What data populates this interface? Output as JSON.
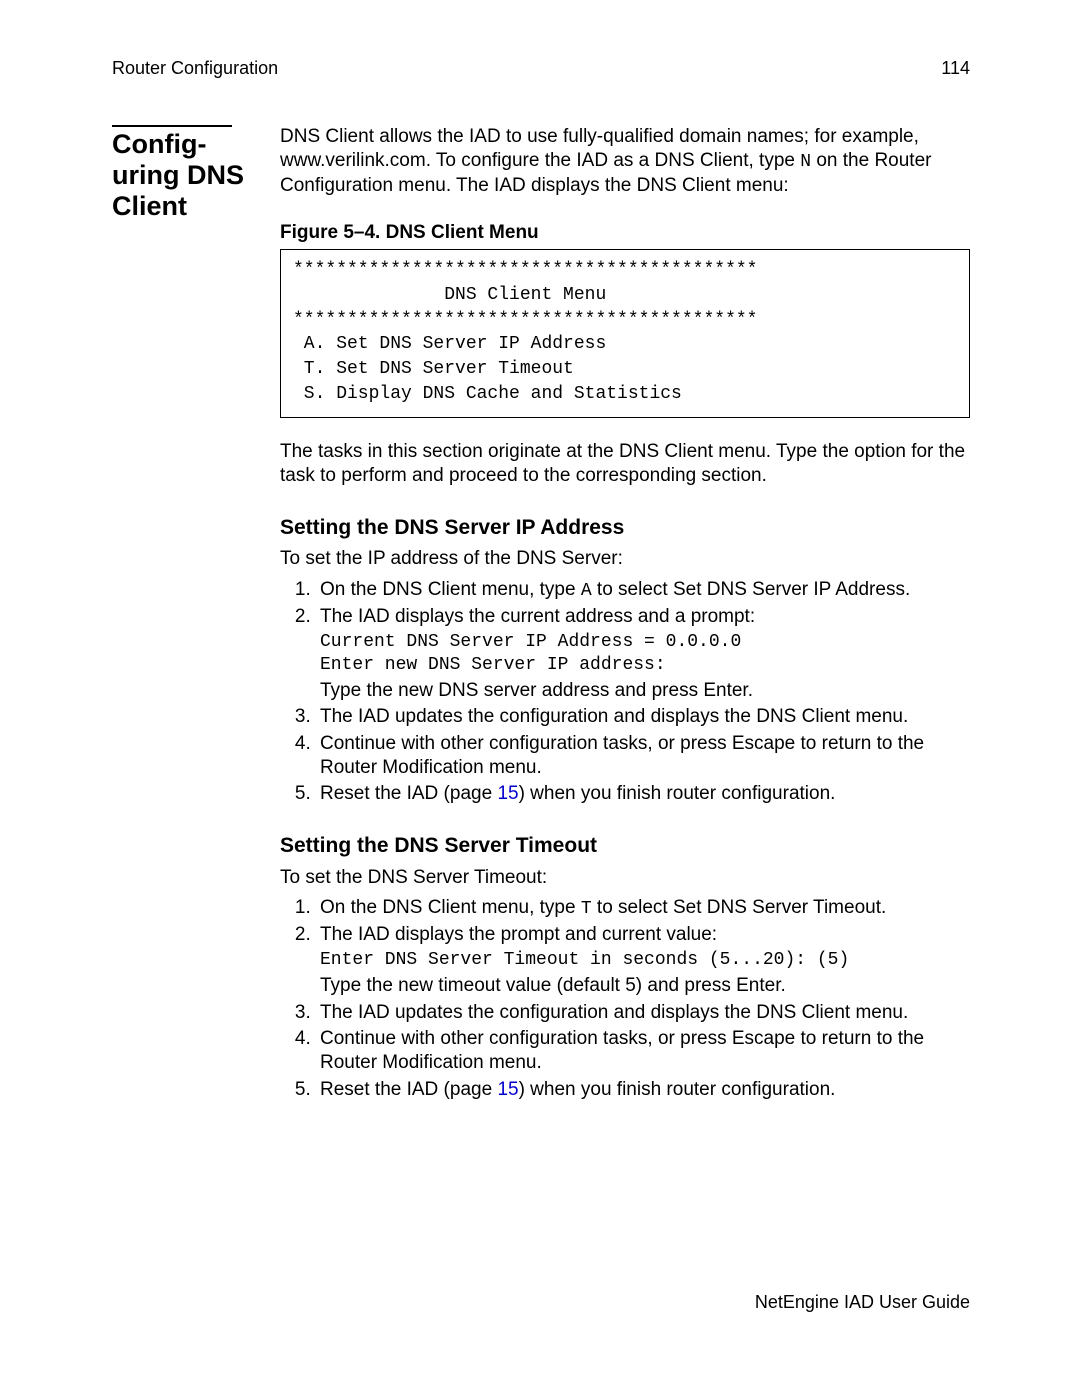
{
  "header": {
    "left": "Router Configuration",
    "right": "114"
  },
  "side_heading": "Config-\nuring DNS\nClient",
  "intro": "DNS Client allows the IAD to use fully-qualified domain names; for example, www.verilink.com. To configure the IAD as a DNS Client, type ",
  "intro_code": "N",
  "intro_tail": " on the Router Configuration menu. The IAD displays the DNS Client menu:",
  "figure_caption": "Figure 5–4.  DNS Client Menu",
  "menu_box": "*******************************************\n              DNS Client Menu\n*******************************************\n A. Set DNS Server IP Address\n T. Set DNS Server Timeout\n S. Display DNS Cache and Statistics",
  "after_menu": "The tasks in this section originate at the DNS Client menu. Type the option for the task to perform and proceed to the corresponding section.",
  "sec1": {
    "heading": "Setting the DNS Server IP Address",
    "lead": "To set the IP address of the DNS Server:",
    "s1_a": "On the DNS Client menu, type ",
    "s1_code": "A",
    "s1_b": " to select Set DNS Server IP Address.",
    "s2_a": "The IAD displays the current address and a prompt:",
    "s2_code": "Current DNS Server IP Address = 0.0.0.0\nEnter new DNS Server IP address:",
    "s2_b": "Type the new DNS server address and press Enter.",
    "s3": "The IAD updates the configuration and displays the DNS Client menu.",
    "s4": "Continue with other configuration tasks, or press Escape to return to the Router Modification menu.",
    "s5_a": "Reset the IAD (page ",
    "s5_link": "15",
    "s5_b": ") when you finish router configuration."
  },
  "sec2": {
    "heading": "Setting the DNS Server Timeout",
    "lead": "To set the DNS Server Timeout:",
    "s1_a": "On the DNS Client menu, type ",
    "s1_code": "T",
    "s1_b": " to select Set DNS Server Timeout.",
    "s2_a": "The IAD displays the prompt and current value:",
    "s2_code": "Enter DNS Server Timeout in seconds (5...20): (5)",
    "s2_b": "Type the new timeout value (default 5) and press Enter.",
    "s3": "The IAD updates the configuration and displays the DNS Client menu.",
    "s4": "Continue with other configuration tasks, or press Escape to return to the Router Modification menu.",
    "s5_a": "Reset the IAD (page ",
    "s5_link": "15",
    "s5_b": ") when you finish router configuration."
  },
  "footer": "NetEngine IAD User Guide"
}
